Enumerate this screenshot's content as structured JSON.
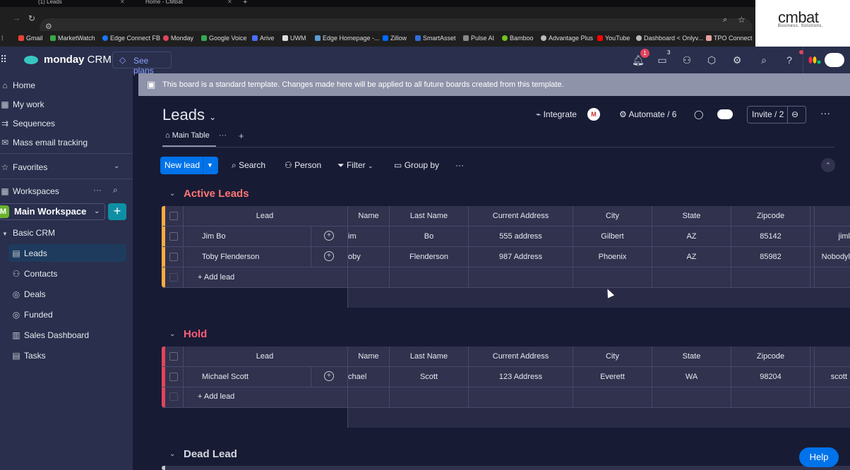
{
  "browser": {
    "tabs": [
      {
        "title": "(1) Leads"
      },
      {
        "title": "Home - CMBat"
      }
    ],
    "new_tab": "+",
    "bookmarks": [
      {
        "label": "Gmail",
        "color": "#ea4335"
      },
      {
        "label": "MarketWatch",
        "color": "#3aa84b"
      },
      {
        "label": "Edge Connect FB",
        "color": "#1877f2"
      },
      {
        "label": "Monday",
        "color": "#e2445c"
      },
      {
        "label": "Google Voice",
        "color": "#34a853"
      },
      {
        "label": "Arive",
        "color": "#4a6cf7"
      },
      {
        "label": "UWM",
        "color": "#dddddd"
      },
      {
        "label": "Edge Homepage -...",
        "color": "#5b9bd5"
      },
      {
        "label": "Zillow",
        "color": "#006aff"
      },
      {
        "label": "SmartAsset",
        "color": "#2f6fde"
      },
      {
        "label": "Pulse AI",
        "color": "#888888"
      },
      {
        "label": "Bamboo",
        "color": "#73c41d"
      },
      {
        "label": "Advantage Plus",
        "color": "#bbbbbb"
      },
      {
        "label": "YouTube",
        "color": "#ff0000"
      },
      {
        "label": "Dashboard < Onlyv...",
        "color": "#bbbbbb"
      },
      {
        "label": "TPO Connect",
        "color": "#e8a0a0"
      }
    ]
  },
  "brand": {
    "name": "cmbat",
    "tagline": "Business. Solutions."
  },
  "topbar": {
    "product_bold": "monday",
    "product_rest": " CRM",
    "see_plans": "See plans",
    "notifications_count": "1",
    "inbox_count": "3",
    "accent": "#0073ea"
  },
  "sidebar": {
    "nav": [
      {
        "label": "Home",
        "icon": "home-icon"
      },
      {
        "label": "My work",
        "icon": "calendar-icon"
      },
      {
        "label": "Sequences",
        "icon": "sequence-icon"
      },
      {
        "label": "Mass email tracking",
        "icon": "email-icon"
      }
    ],
    "favorites": "Favorites",
    "workspaces": "Workspaces",
    "workspace_badge": "M",
    "workspace_name": "Main Workspace",
    "folder": "Basic CRM",
    "boards": [
      {
        "label": "Leads",
        "icon": "board-icon"
      },
      {
        "label": "Contacts",
        "icon": "person-icon"
      },
      {
        "label": "Deals",
        "icon": "deals-icon"
      },
      {
        "label": "Funded",
        "icon": "funded-icon"
      },
      {
        "label": "Sales Dashboard",
        "icon": "dashboard-icon"
      },
      {
        "label": "Tasks",
        "icon": "board-icon"
      }
    ]
  },
  "banner": "This board is a standard template. Changes made here will be applied to all future boards created from this template.",
  "board": {
    "title": "Leads",
    "integrate": "Integrate",
    "automate": "Automate / 6",
    "invite": "Invite / 2",
    "main_tab": "Main Table",
    "tab_more": "···",
    "tab_add": "+"
  },
  "toolbar": {
    "new_item": "New lead",
    "search": "Search",
    "person": "Person",
    "filter": "Filter",
    "group_by": "Group by",
    "more": "···"
  },
  "columns": [
    "Lead",
    "Name",
    "Last Name",
    "Current Address",
    "City",
    "State",
    "Zipcode"
  ],
  "groups": [
    {
      "title": "Active Leads",
      "color": "#fdab3d",
      "title_color": "#ff7575",
      "add_label": "+ Add lead",
      "rows": [
        {
          "lead": "Jim Bo",
          "name": "im",
          "last": "Bo",
          "address": "555 address",
          "city": "Gilbert",
          "state": "AZ",
          "zip": "85142",
          "extra": "jiml"
        },
        {
          "lead": "Toby Flenderson",
          "name": "oby",
          "last": "Flenderson",
          "address": "987 Address",
          "city": "Phoenix",
          "state": "AZ",
          "zip": "85982",
          "extra": "Nobodyl"
        }
      ]
    },
    {
      "title": "Hold",
      "color": "#e2445c",
      "title_color": "#ff5c78",
      "add_label": "+ Add lead",
      "rows": [
        {
          "lead": "Michael Scott",
          "name": "chael",
          "last": "Scott",
          "address": "123 Address",
          "city": "Everett",
          "state": "WA",
          "zip": "98204",
          "extra": "scott"
        }
      ]
    },
    {
      "title": "Dead Lead",
      "color": "#c4c4c4",
      "title_color": "#d5d8df",
      "rows": []
    }
  ],
  "help": "Help"
}
